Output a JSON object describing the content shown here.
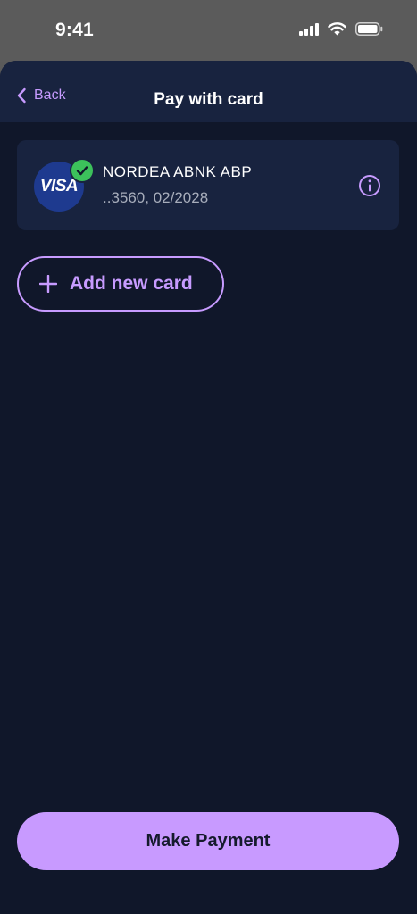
{
  "status_bar": {
    "time": "9:41"
  },
  "nav": {
    "back_label": "Back",
    "title": "Pay with card"
  },
  "card": {
    "brand": "VISA",
    "bank_name": "NORDEA ABNK ABP",
    "details": "..3560, 02/2028",
    "selected": true
  },
  "actions": {
    "add_card_label": "Add new card",
    "pay_label": "Make Payment"
  },
  "colors": {
    "accent": "#c79bff",
    "background": "#10172a",
    "surface": "#18233f",
    "success": "#3cc15b"
  }
}
